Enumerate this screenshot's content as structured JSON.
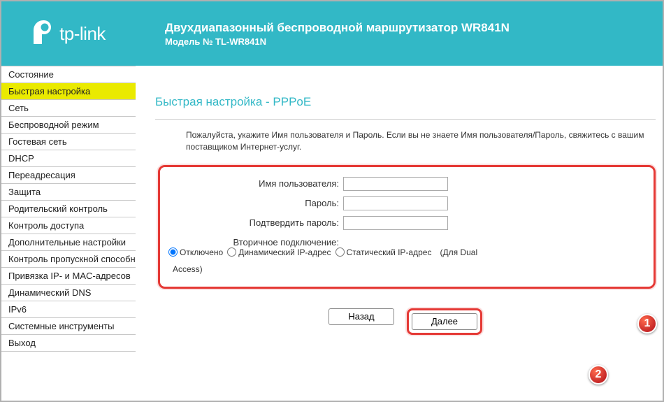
{
  "header": {
    "brand": "tp-link",
    "title": "Двухдиапазонный беспроводной маршрутизатор WR841N",
    "subtitle": "Модель № TL-WR841N"
  },
  "sidebar": {
    "items": [
      "Состояние",
      "Быстрая настройка",
      "Сеть",
      "Беспроводной режим",
      "Гостевая сеть",
      "DHCP",
      "Переадресация",
      "Защита",
      "Родительский контроль",
      "Контроль доступа",
      "Дополнительные настройки",
      "Контроль пропускной способности",
      "Привязка IP- и MAC-адресов",
      "Динамический DNS",
      "IPv6",
      "Системные инструменты",
      "Выход"
    ],
    "activeIndex": 1
  },
  "content": {
    "title": "Быстрая настройка - PPPoE",
    "instruction": "Пожалуйста, укажите Имя пользователя и Пароль. Если вы не знаете Имя пользователя/Пароль, свяжитесь с вашим поставщиком Интернет-услуг.",
    "fields": {
      "username_label": "Имя пользователя:",
      "password_label": "Пароль:",
      "confirm_label": "Подтвердить пароль:",
      "secondary_label": "Вторичное подключение:",
      "username_value": "",
      "password_value": "",
      "confirm_value": ""
    },
    "radios": {
      "disabled": "Отключено",
      "dynamic": "Динамический IP-адрес",
      "static": "Статический IP-адрес",
      "suffix": "(Для Dual",
      "access_line": "Access)"
    },
    "buttons": {
      "back": "Назад",
      "next": "Далее"
    }
  },
  "badges": {
    "one": "1",
    "two": "2"
  }
}
